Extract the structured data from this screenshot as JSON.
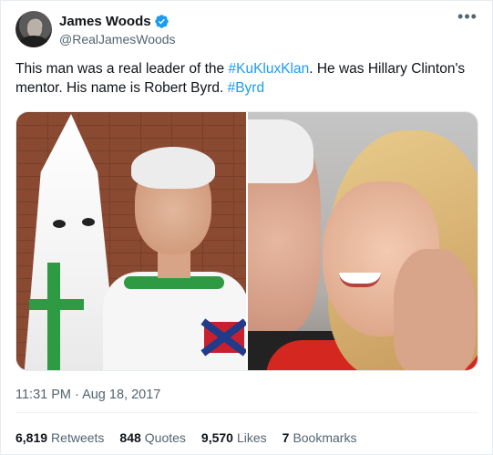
{
  "author": {
    "display_name": "James Woods",
    "handle": "@RealJamesWoods",
    "verified": true,
    "avatar_icon": "avatar-photo"
  },
  "menu_icon": "more-horizontal-icon",
  "tweet": {
    "segments": [
      {
        "type": "text",
        "value": "This man was a real leader of the "
      },
      {
        "type": "hashtag",
        "value": "#KuKluxKlan"
      },
      {
        "type": "text",
        "value": ". He was Hillary Clinton's mentor. His name is Robert Byrd. "
      },
      {
        "type": "hashtag",
        "value": "#Byrd"
      }
    ]
  },
  "media": {
    "left_image": "photo-man-in-klan-robe",
    "right_image": "photo-kiss-on-cheek"
  },
  "timestamp": "11:31 PM · Aug 18, 2017",
  "stats": [
    {
      "count": "6,819",
      "label": "Retweets"
    },
    {
      "count": "848",
      "label": "Quotes"
    },
    {
      "count": "9,570",
      "label": "Likes"
    },
    {
      "count": "7",
      "label": "Bookmarks"
    }
  ],
  "colors": {
    "link": "#1d9bf0",
    "text": "#0f1419",
    "secondary": "#536471"
  }
}
